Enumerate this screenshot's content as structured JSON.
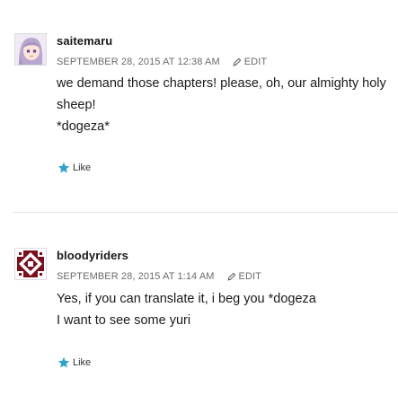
{
  "comments": [
    {
      "author": "saitemaru",
      "date": "SEPTEMBER 28, 2015 AT 12:38 AM",
      "edit_label": "EDIT",
      "lines": [
        "we demand those chapters! please, oh, our almighty holy sheep!",
        "*dogeza*"
      ],
      "like_label": "Like"
    },
    {
      "author": "bloodyriders",
      "date": "SEPTEMBER 28, 2015 AT 1:14 AM",
      "edit_label": "EDIT",
      "lines": [
        "Yes, if you can translate it, i beg you *dogeza",
        "I want to see some yuri"
      ],
      "like_label": "Like"
    }
  ],
  "colors": {
    "like_star": "#2ea2cc",
    "meta_text": "#6b6b6b",
    "avatar_accent": "#7a0f1e",
    "avatar_hair": "#b9a7cf"
  },
  "icons": {
    "edit": "pencil-icon",
    "like": "star-icon"
  }
}
